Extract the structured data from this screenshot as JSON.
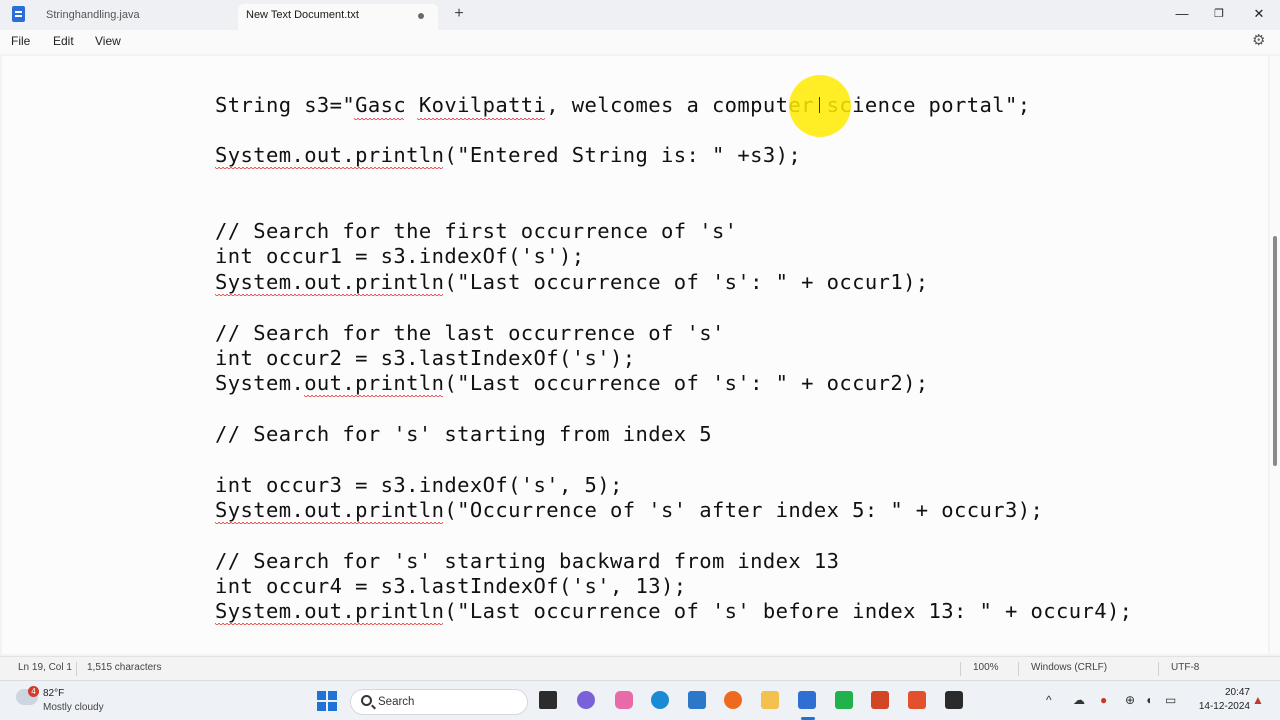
{
  "tabs": [
    {
      "label": "Stringhandling.java",
      "active": false
    },
    {
      "label": "New Text Document.txt",
      "active": true
    }
  ],
  "new_tab_label": "+",
  "window_controls": {
    "minimize": "—",
    "maximize": "❐",
    "close": "✕"
  },
  "menu": [
    "File",
    "Edit",
    "View"
  ],
  "code_lines": [
    "String s3=\"Gasc Kovilpatti, welcomes a computer science portal\";",
    "",
    "System.out.println(\"Entered String is: \" +s3);",
    "",
    "",
    "// Search for the first occurrence of 's'",
    "int occur1 = s3.indexOf('s');",
    "System.out.println(\"Last occurrence of 's': \" + occur1);",
    "",
    "// Search for the last occurrence of 's'",
    "int occur2 = s3.lastIndexOf('s');",
    "System.out.println(\"Last occurrence of 's': \" + occur2);",
    "",
    "// Search for 's' starting from index 5",
    "",
    "int occur3 = s3.indexOf('s', 5);",
    "System.out.println(\"Occurrence of 's' after index 5: \" + occur3);",
    "",
    "// Search for 's' starting backward from index 13",
    "int occur4 = s3.lastIndexOf('s', 13);",
    "System.out.println(\"Last occurrence of 's' before index 13: \" + occur4);"
  ],
  "status": {
    "position": "Ln 19, Col 1",
    "characters": "1,515 characters",
    "zoom": "100%",
    "line_ending": "Windows (CRLF)",
    "encoding": "UTF-8"
  },
  "taskbar": {
    "weather_badge": "4",
    "weather_temp": "82°F",
    "weather_condition": "Mostly cloudy",
    "search_placeholder": "Search",
    "apps": [
      "task-view",
      "copilot",
      "m365",
      "edge",
      "store",
      "firefox",
      "file-explorer",
      "notepad",
      "pycharm",
      "powerpoint",
      "feedback",
      "terminal"
    ],
    "tray_caret": "^",
    "time": "20:47",
    "date": "14-12-2024"
  },
  "colors": {
    "start_blue": "#1f73d6",
    "squiggle_red": "#e03a3a",
    "highlight_yellow": "#ffeb00"
  }
}
